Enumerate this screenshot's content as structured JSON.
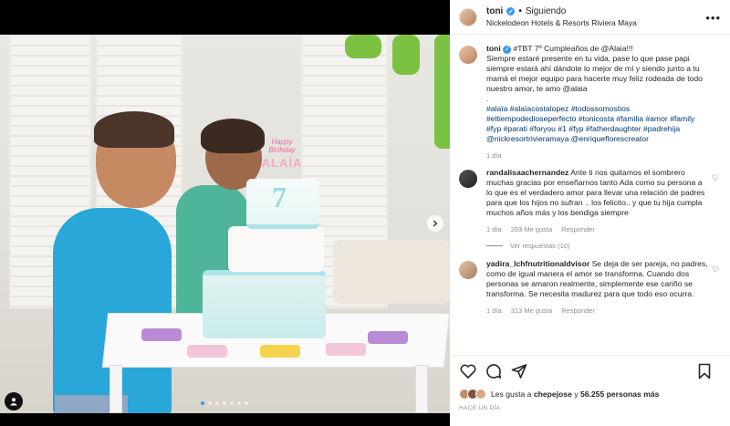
{
  "post": {
    "username": "toni",
    "follow_status": "Siguiendo",
    "location": "Nickelodeon Hotels & Resorts Riviera Maya",
    "cake_topper": "Happy Birthday",
    "cake_name": "ALAÍA",
    "cake_number": "7"
  },
  "caption": {
    "username": "toni",
    "line1": "#TBT 7º Cumpleaños de @Alaia!!!",
    "body": "Siempre estaré presente en tu vida, pase lo que pase papi siempre estará ahí dándote lo mejor de mí y siendo junto a tu mamá el mejor equipo para hacerte muy feliz rodeada de todo nuestro amor, te amo @alaia",
    "dot": ".",
    "hashtags": "#alaïa #alaïacostalopez #todossomostios #eltiempodedioseperfecto #tonicosta #familia #amor #family #fyp #parati #foryou #1 #fyp #fatherdaughter #padrehija @nickresortrivieramaya @enriqueflorescreator",
    "time": "1 día"
  },
  "comments": [
    {
      "username": "randalisaacher nandez",
      "username_display": "randalisaacher­nandez",
      "text": "Ante ti nos quitamos el sombrero muchas gracias por enseñarnos tanto Ada como su persona a lo que es el verdadero amor para llevar una relación de padres para que los hijos no sufran .. los felicito.. y que tu hija cumpla muchos años más y los bendiga siempre",
      "time": "1 día",
      "likes": "203 Me gusta",
      "reply": "Responder",
      "view_replies": "Ver respuestas (10)"
    },
    {
      "username_display": "yadira_lchfnutritionaldvisor",
      "text": "Se deja de ser pareja, no padres, como de igual manera el amor se transforma. Cuando dos personas se amaron realmente, simplemente ese cariño se transforma. Se necesita madurez para que todo eso ocurra.",
      "time": "1 día",
      "likes": "313 Me gusta",
      "reply": "Responder"
    }
  ],
  "footer": {
    "likes_prefix": "Les gusta a",
    "likes_user": "chepejose",
    "likes_joiner": "y",
    "likes_count": "56.255 personas más",
    "timestamp": "HACE UN DÍA"
  },
  "colors": {
    "accent": "#3897f0",
    "link": "#00376b",
    "muted": "#8e8e8e",
    "text": "#262626"
  },
  "icons": [
    "heart-icon",
    "comment-icon",
    "share-icon",
    "bookmark-icon",
    "more-icon",
    "verified-icon",
    "chevron-right-icon",
    "user-tag-icon"
  ]
}
